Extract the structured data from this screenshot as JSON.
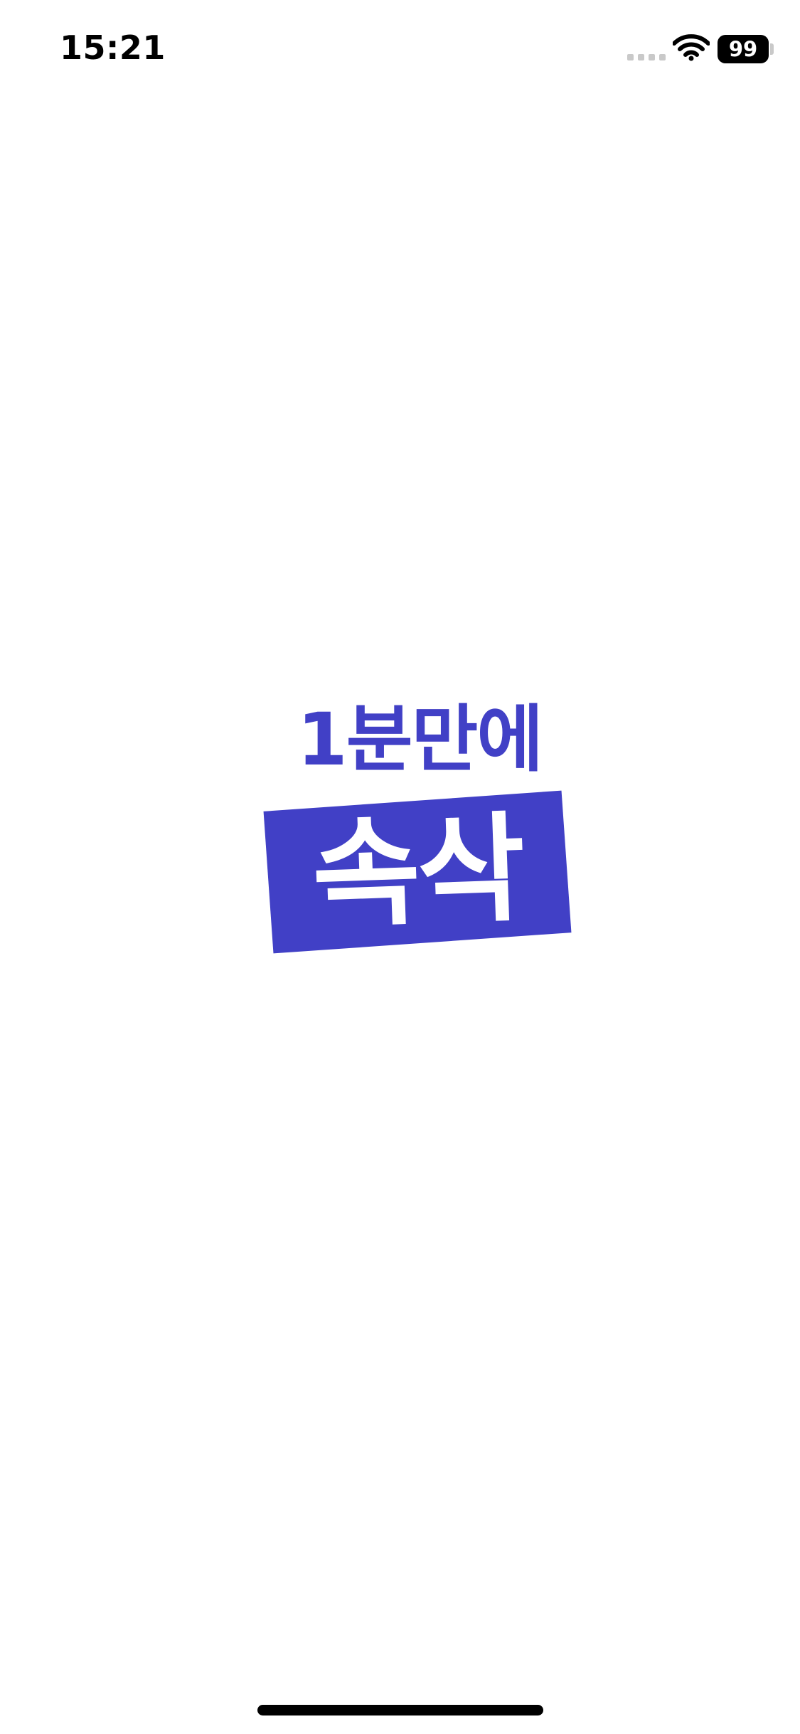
{
  "status_bar": {
    "time": "15:21",
    "battery_level": "99",
    "wifi_icon": "wifi-icon",
    "signal_icon": "cellular-signal-icon"
  },
  "splash": {
    "logo_line1": "1분만에",
    "logo_line2": "속삭",
    "brand_color": "#4140c6"
  }
}
